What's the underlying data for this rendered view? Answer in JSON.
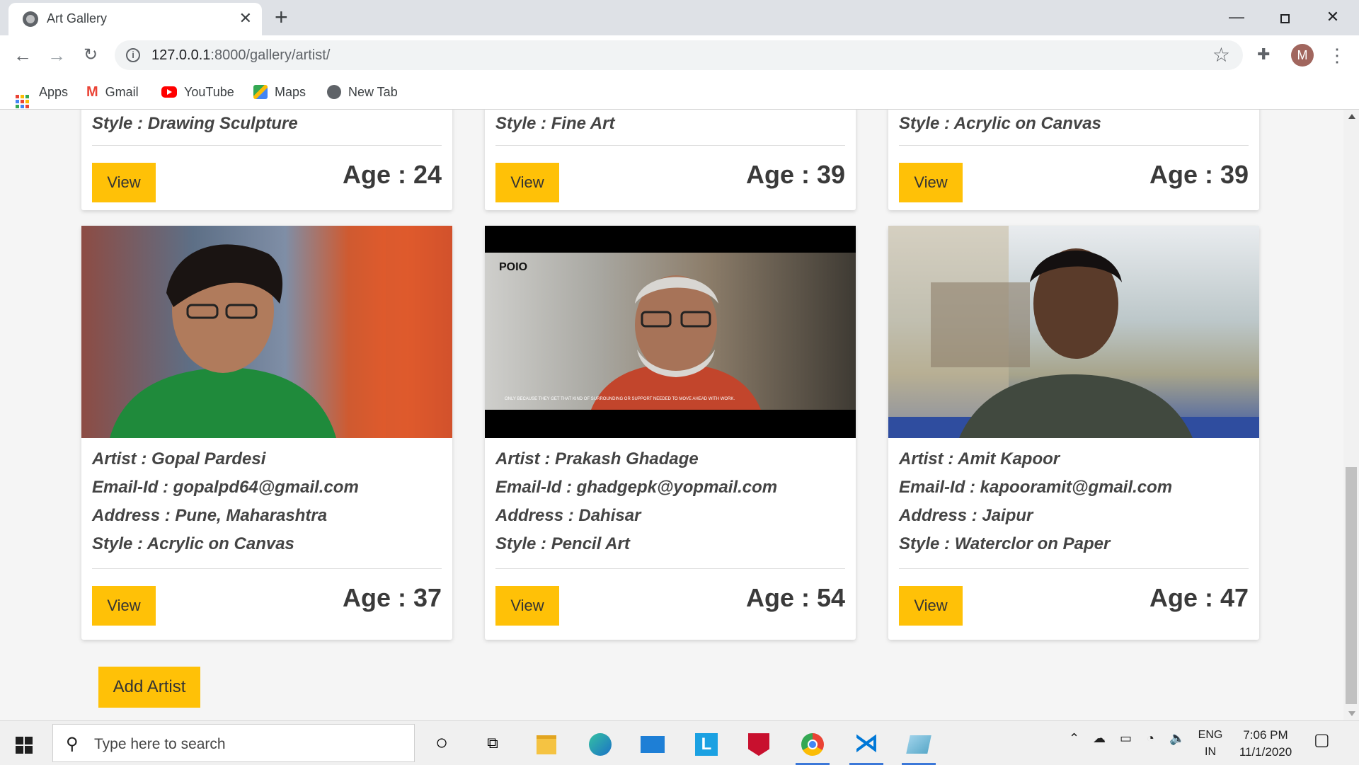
{
  "browser": {
    "tab_title": "Art Gallery",
    "tab_close": "✕",
    "new_tab": "+",
    "url_host": "127.0.0.1",
    "url_path": ":8000/gallery/artist/",
    "avatar_initial": "M",
    "bookmarks": [
      {
        "label": "Apps",
        "icon": "apps-grid-icon"
      },
      {
        "label": "Gmail",
        "icon": "gmail-icon"
      },
      {
        "label": "YouTube",
        "icon": "youtube-icon"
      },
      {
        "label": "Maps",
        "icon": "maps-icon"
      },
      {
        "label": "New Tab",
        "icon": "globe-icon"
      }
    ]
  },
  "top_cards": [
    {
      "style": "Style : Drawing Sculpture",
      "view": "View",
      "age": "Age : 24"
    },
    {
      "style": "Style : Fine Art",
      "view": "View",
      "age": "Age : 39"
    },
    {
      "style": "Style : Acrylic on Canvas",
      "view": "View",
      "age": "Age : 39"
    }
  ],
  "cards": [
    {
      "artist": "Artist : Gopal Pardesi",
      "email": "Email-Id : gopalpd64@gmail.com",
      "address": "Address : Pune, Maharashtra",
      "style": "Style : Acrylic on Canvas",
      "view": "View",
      "age": "Age : 37"
    },
    {
      "artist": "Artist : Prakash Ghadage",
      "email": "Email-Id : ghadgepk@yopmail.com",
      "address": "Address : Dahisar",
      "style": "Style : Pencil Art",
      "view": "View",
      "age": "Age : 54",
      "photo_logo": "POIO",
      "photo_caption": "ONLY BECAUSE THEY GET THAT KIND OF SURROUNDING OR SUPPORT NEEDED TO MOVE AHEAD WITH WORK."
    },
    {
      "artist": "Artist : Amit Kapoor",
      "email": "Email-Id : kapooramit@gmail.com",
      "address": "Address : Jaipur",
      "style": "Style : Waterclor on Paper",
      "view": "View",
      "age": "Age : 47"
    }
  ],
  "add_artist": "Add Artist",
  "taskbar": {
    "search_placeholder": "Type here to search",
    "lang_top": "ENG",
    "lang_bottom": "IN",
    "time": "7:06 PM",
    "date": "11/1/2020"
  },
  "colors": {
    "accent": "#ffc107"
  }
}
